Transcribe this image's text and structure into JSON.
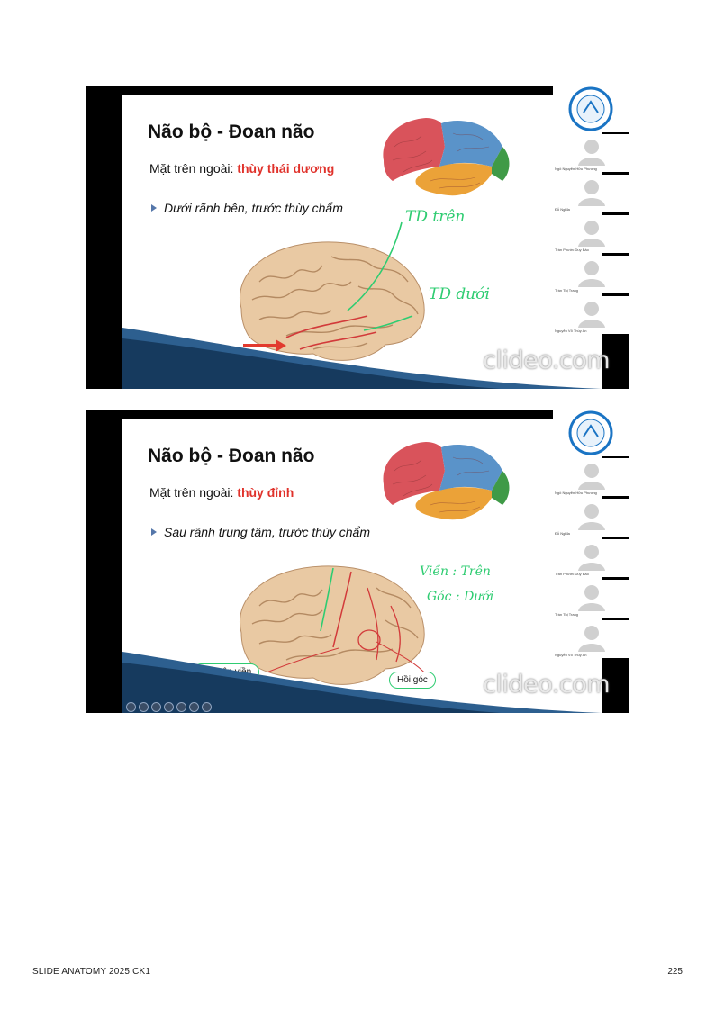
{
  "slides": [
    {
      "title": "Não bộ - Đoan não",
      "subtitle_prefix": "Mặt trên ngoài: ",
      "subtitle_highlight": "thùy thái dương",
      "bullet": "Dưới rãnh bên, trước thùy chẩm",
      "annotations": [
        "TD trên",
        "TD dưới"
      ],
      "watermark": "clideo.com",
      "participants": [
        "Ngô Nguyễn Hữu Phương",
        "Đỗ Nghĩa",
        "Trần Phước Duy Bảo",
        "Trần Thị Trang",
        "Nguyễn Võ Thúy An"
      ]
    },
    {
      "title": "Não bộ - Đoan não",
      "subtitle_prefix": "Mặt trên ngoài: ",
      "subtitle_highlight": "thùy đỉnh",
      "bullet": "Sau rãnh trung tâm, trước thùy chẩm",
      "annotations": [
        "Viền : Trên",
        "Góc : Dưới"
      ],
      "callouts": [
        "Hồi trên viền",
        "Hồi góc"
      ],
      "watermark": "clideo.com",
      "participants": [
        "Ngô Nguyễn Hữu Phương",
        "Đỗ Nghĩa",
        "Trần Phước Duy Bảo",
        "Trần Thị Trang",
        "Nguyễn Võ Thúy An"
      ]
    }
  ],
  "colors": {
    "highlight": "#e0322b",
    "annotation": "#2ecc71",
    "frontal": "#d9535b",
    "parietal": "#5a93c9",
    "temporal": "#eba238",
    "occipital": "#3f9a47"
  },
  "footer": {
    "left": "SLIDE ANATOMY 2025 CK1",
    "right": "225"
  }
}
